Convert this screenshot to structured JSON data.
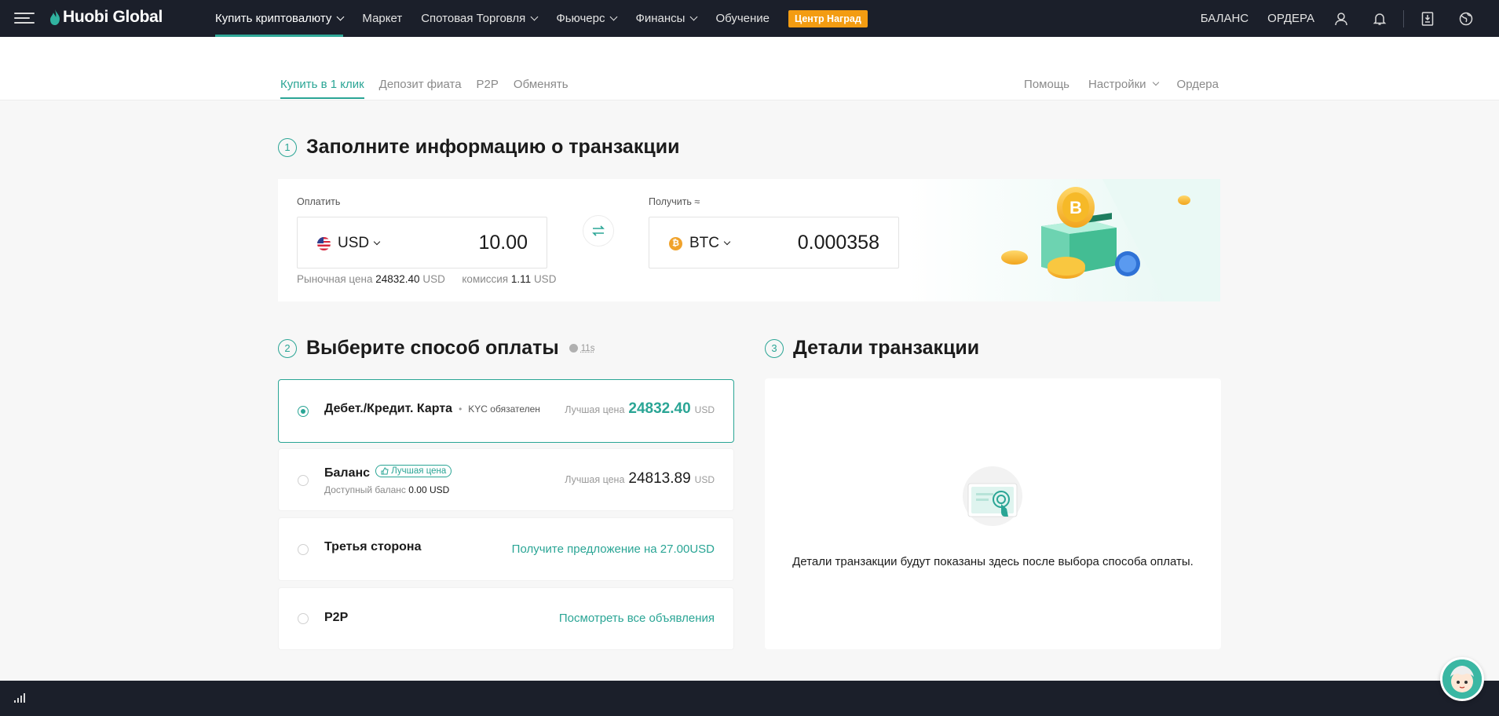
{
  "header": {
    "logo_text": "Huobi Global",
    "nav": [
      {
        "label": "Купить криптовалюту",
        "dropdown": true,
        "active": true
      },
      {
        "label": "Маркет",
        "dropdown": false
      },
      {
        "label": "Спотовая Торговля",
        "dropdown": true
      },
      {
        "label": "Фьючерс",
        "dropdown": true
      },
      {
        "label": "Финансы",
        "dropdown": true
      },
      {
        "label": "Обучение",
        "dropdown": false
      }
    ],
    "rewards_label": "Центр Наград",
    "balance_label": "БАЛАНС",
    "orders_label": "ОРДЕРА",
    "icons": [
      "user-icon",
      "bell-icon",
      "download-icon",
      "globe-icon"
    ]
  },
  "subnav": {
    "tabs": [
      "Купить в 1 клик",
      "Депозит фиата",
      "P2P",
      "Обменять"
    ],
    "active_tab": 0,
    "help": "Помощь",
    "settings": "Настройки",
    "orders": "Ордера"
  },
  "step1": {
    "num": "1",
    "title": "Заполните информацию о транзакции",
    "pay_label": "Оплатить",
    "pay_currency": "USD",
    "pay_amount": "10.00",
    "receive_label": "Получить ≈",
    "receive_currency": "BTC",
    "receive_amount": "0.000358",
    "market_price_label": "Рыночная цена",
    "market_price": "24832.40",
    "market_price_unit": "USD",
    "fee_label": "комиссия",
    "fee": "1.11",
    "fee_unit": "USD"
  },
  "step2": {
    "num": "2",
    "title": "Выберите способ оплаты",
    "timer": "11s",
    "methods": [
      {
        "name": "Дебет./Кредит. Карта",
        "kyc": "KYC обязателен",
        "best_label": "Лучшая цена",
        "best_value": "24832.40",
        "unit": "USD",
        "selected": true
      },
      {
        "name": "Баланс",
        "badge": "Лучшая цена",
        "sub_label": "Доступный баланс",
        "sub_value": "0.00 USD",
        "best_label": "Лучшая цена",
        "best_value": "24813.89",
        "unit": "USD",
        "selected": false
      },
      {
        "name": "Третья сторона",
        "link": "Получите предложение на 27.00USD",
        "selected": false
      },
      {
        "name": "P2P",
        "link": "Посмотреть все объявления",
        "selected": false
      }
    ]
  },
  "step3": {
    "num": "3",
    "title": "Детали транзакции",
    "empty_text": "Детали транзакции будут показаны здесь после выбора способа оплаты."
  },
  "colors": {
    "accent": "#2aa595",
    "header_bg": "#1b1f2a",
    "rewards": "#f39c12"
  }
}
